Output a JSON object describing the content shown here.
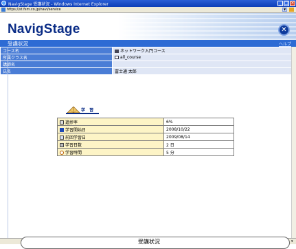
{
  "window": {
    "title": "NavigStage 受講状況 - Windows Internet Explorer"
  },
  "address": {
    "url": "https://st.fsm.co.jp/navi/service"
  },
  "brand": {
    "logo": "NavigStage"
  },
  "section": {
    "title": "受講状況",
    "help_label": "ヘルプ"
  },
  "info_rows": [
    {
      "label": "コース名",
      "value": "ネットワーク入門コース",
      "icon": "book-icon"
    },
    {
      "label": "所属クラス名",
      "value": "all_course",
      "icon": "class-icon"
    },
    {
      "label": "講師名",
      "value": ""
    },
    {
      "label": "氏名",
      "value": "富士通 太郎"
    }
  ],
  "study": {
    "label": "学 習"
  },
  "stats": [
    {
      "label": "進捗率",
      "value": "6%",
      "icon": "progress-icon"
    },
    {
      "label": "学習開始日",
      "value": "2008/10/22",
      "icon": "start-date-icon"
    },
    {
      "label": "前回学習日",
      "value": "2009/08/14",
      "icon": "last-date-icon"
    },
    {
      "label": "学習日数",
      "value": "2 日",
      "icon": "study-days-icon"
    },
    {
      "label": "学習時間",
      "value": "5 分",
      "icon": "study-time-icon"
    }
  ],
  "status": {
    "bubble_text": "受講状況"
  }
}
